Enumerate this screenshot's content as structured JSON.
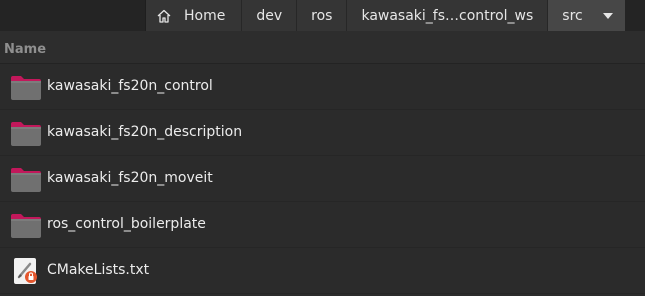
{
  "pathbar": {
    "home": "Home",
    "crumbs": [
      "dev",
      "ros",
      "kawasaki_fs…control_ws"
    ],
    "current": "src"
  },
  "columns": {
    "name": "Name"
  },
  "files": [
    {
      "name": "kawasaki_fs20n_control",
      "type": "folder"
    },
    {
      "name": "kawasaki_fs20n_description",
      "type": "folder"
    },
    {
      "name": "kawasaki_fs20n_moveit",
      "type": "folder"
    },
    {
      "name": "ros_control_boilerplate",
      "type": "folder"
    },
    {
      "name": "CMakeLists.txt",
      "type": "text-file-locked"
    }
  ],
  "colors": {
    "folder_body": "#707070",
    "folder_tab": "#c2185b",
    "background": "#2b2b2b"
  }
}
